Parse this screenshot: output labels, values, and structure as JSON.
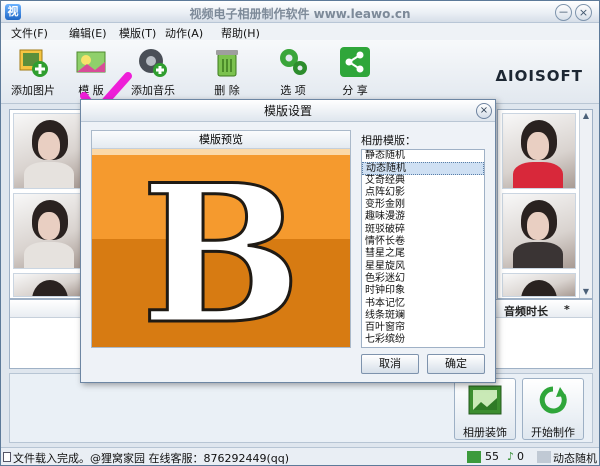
{
  "window": {
    "title": "视频电子相册制作软件 www.leawo.cn",
    "minimize": "－",
    "close": "×"
  },
  "menu": [
    "文件(F)",
    "编辑(E)",
    "模版(T)",
    "动作(A)",
    "帮助(H)"
  ],
  "toolbar": [
    {
      "label": "添加图片",
      "icon": "add-picture-icon"
    },
    {
      "label": "模 版",
      "icon": "template-icon"
    },
    {
      "label": "添加音乐",
      "icon": "add-music-icon"
    },
    {
      "label": "删 除",
      "icon": "trash-icon"
    },
    {
      "label": "选 项",
      "icon": "gear-icon"
    },
    {
      "label": "分 享",
      "icon": "share-icon"
    }
  ],
  "brand": "ΔIOISOFT",
  "list": {
    "columns": [
      "音频时长",
      "*"
    ]
  },
  "bottom": {
    "decorate_label": "相册装饰",
    "start_label": "开始制作"
  },
  "status": {
    "text": "文件载入完成。@狸窝家园 在线客服：876292449(qq)",
    "images_count": "55",
    "music_count": "0",
    "template_name": "动态随机"
  },
  "dialog": {
    "title": "模版设置",
    "preview_label": "模版预览",
    "preview_letter": "B",
    "template_label": "相册模版：",
    "templates": [
      "静态随机",
      "动态随机",
      "艾奇经典",
      "点阵幻影",
      "变形金刚",
      "趣味漫游",
      "斑驳破碎",
      "情怀长卷",
      "彗星之尾",
      "星星旋风",
      "色彩迷幻",
      "时钟印象",
      "书本记忆",
      "线条斑斓",
      "百叶窗帘",
      "七彩缤纷"
    ],
    "selected_index": 1,
    "cancel_label": "取消",
    "ok_label": "确定",
    "close_label": "×"
  },
  "colors": {
    "preview_top": "#f59a2e",
    "preview_bottom": "#d77b12",
    "checkmark": "#ee1fd8"
  }
}
